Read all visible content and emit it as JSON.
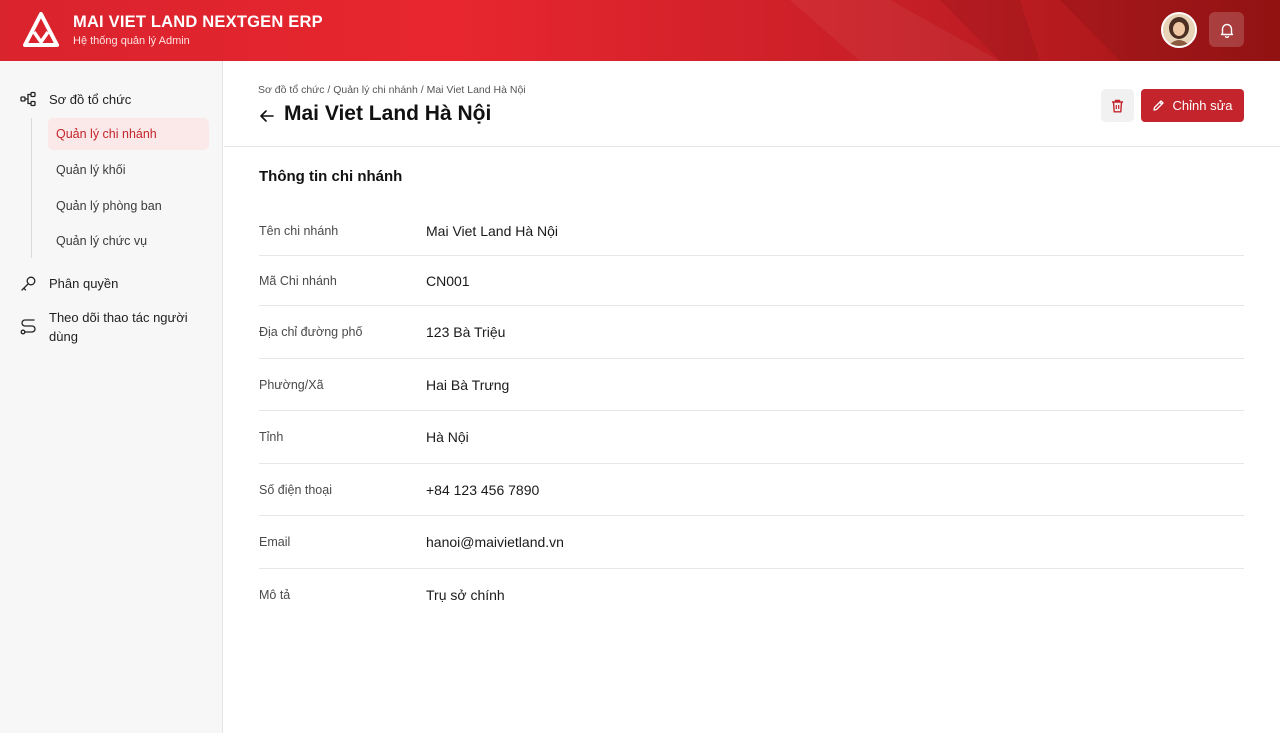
{
  "header": {
    "title": "MAI VIET LAND NEXTGEN ERP",
    "subtitle": "Hệ thống quản lý Admin",
    "accent": "#d9232d"
  },
  "sidebar": {
    "groups": [
      {
        "label": "Sơ đồ tổ chức",
        "icon": "org-chart-icon"
      },
      {
        "label": "Phân quyền",
        "icon": "key-icon"
      },
      {
        "label": "Theo dõi thao tác người dùng",
        "icon": "route-icon"
      }
    ],
    "sub_items": [
      {
        "label": "Quản lý chi nhánh",
        "active": true
      },
      {
        "label": "Quản lý khối",
        "active": false
      },
      {
        "label": "Quản lý phòng ban",
        "active": false
      },
      {
        "label": "Quản lý chức vụ",
        "active": false
      }
    ]
  },
  "page": {
    "breadcrumb": "Sơ đồ tổ chức / Quản lý chi nhánh / Mai Viet Land Hà Nội",
    "title": "Mai Viet Land Hà Nội",
    "edit_label": "Chỉnh sửa",
    "section_title": "Thông tin chi nhánh"
  },
  "fields": [
    {
      "label": "Tên chi nhánh",
      "value": "Mai Viet Land Hà Nội"
    },
    {
      "label": "Mã Chi nhánh",
      "value": "CN001"
    },
    {
      "label": "Địa chỉ đường phố",
      "value": "123 Bà Triệu"
    },
    {
      "label": "Phường/Xã",
      "value": "Hai Bà Trưng"
    },
    {
      "label": "Tỉnh",
      "value": "Hà Nội"
    },
    {
      "label": "Số điện thoại",
      "value": "+84 123 456 7890"
    },
    {
      "label": "Email",
      "value": "hanoi@maivietland.vn"
    },
    {
      "label": "Mô tả",
      "value": "Trụ sở chính"
    }
  ]
}
